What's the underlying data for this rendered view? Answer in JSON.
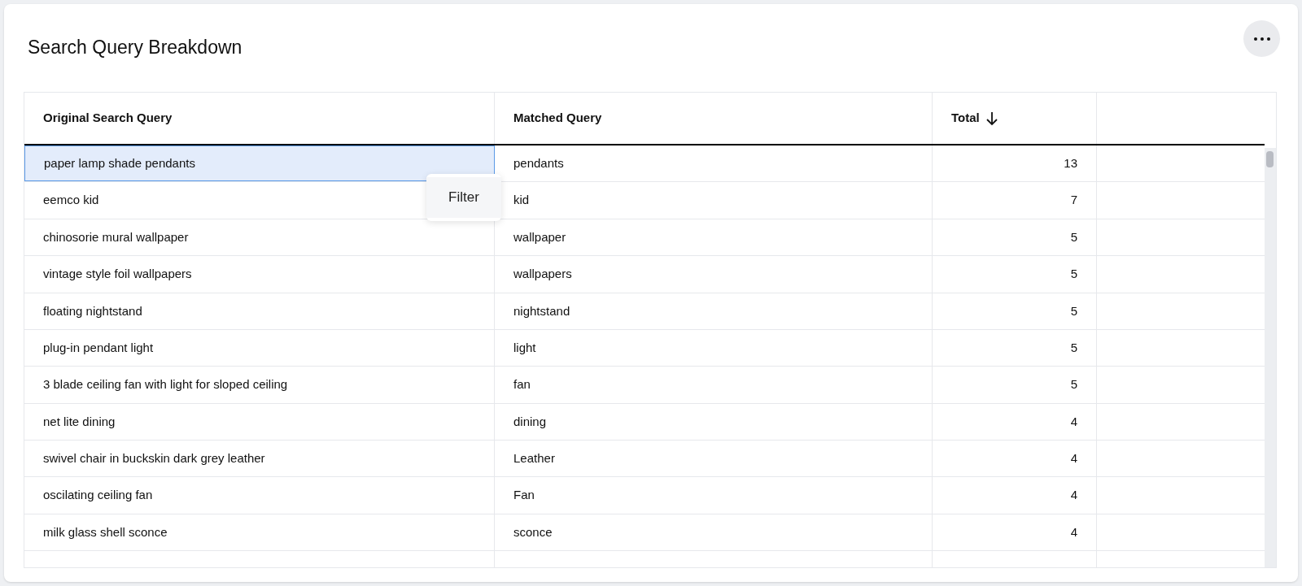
{
  "title": "Search Query Breakdown",
  "columns": [
    {
      "label": "Original Search Query",
      "sorted": false
    },
    {
      "label": "Matched Query",
      "sorted": false
    },
    {
      "label": "Total",
      "sorted": true
    }
  ],
  "rows": [
    {
      "cells": [
        "paper lamp shade pendants",
        "pendants",
        "13"
      ],
      "selected": true
    },
    {
      "cells": [
        "eemco kid",
        "kid",
        "7"
      ],
      "selected": false
    },
    {
      "cells": [
        "chinosorie mural wallpaper",
        "wallpaper",
        "5"
      ],
      "selected": false
    },
    {
      "cells": [
        "vintage style foil wallpapers",
        "wallpapers",
        "5"
      ],
      "selected": false
    },
    {
      "cells": [
        "floating nightstand",
        "nightstand",
        "5"
      ],
      "selected": false
    },
    {
      "cells": [
        "plug-in pendant light",
        "light",
        "5"
      ],
      "selected": false
    },
    {
      "cells": [
        "3 blade ceiling fan with light for sloped ceiling",
        "fan",
        "5"
      ],
      "selected": false
    },
    {
      "cells": [
        "net lite dining",
        "dining",
        "4"
      ],
      "selected": false
    },
    {
      "cells": [
        "swivel chair in buckskin dark grey leather",
        "Leather",
        "4"
      ],
      "selected": false
    },
    {
      "cells": [
        "oscilating ceiling fan",
        "Fan",
        "4"
      ],
      "selected": false
    },
    {
      "cells": [
        "milk glass shell sconce",
        "sconce",
        "4"
      ],
      "selected": false
    }
  ],
  "context_menu": {
    "items": [
      "Filter"
    ]
  }
}
